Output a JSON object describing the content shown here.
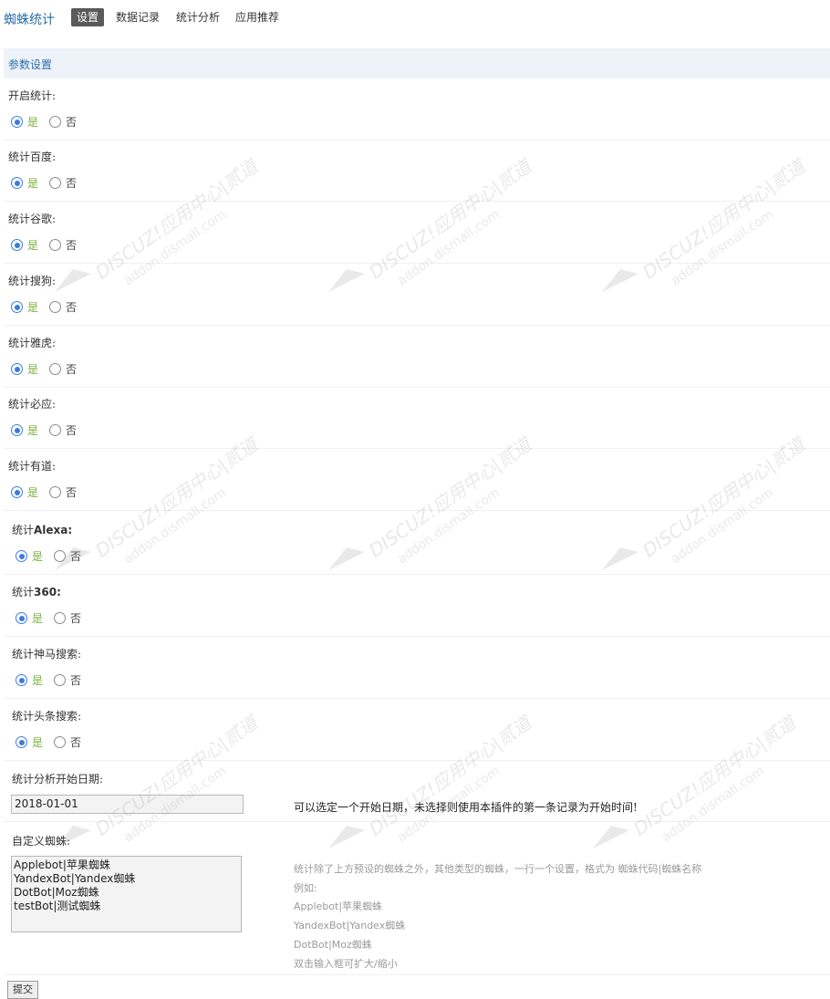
{
  "header": {
    "app_title": "蜘蛛统计",
    "tabs": [
      {
        "label": "设置",
        "active": true
      },
      {
        "label": "数据记录",
        "active": false
      },
      {
        "label": "统计分析",
        "active": false
      },
      {
        "label": "应用推荐",
        "active": false
      }
    ]
  },
  "section": {
    "title": "参数设置"
  },
  "options": {
    "yes": "是",
    "no": "否"
  },
  "settings": [
    {
      "label": "开启统计:",
      "value": "是"
    },
    {
      "label": "统计百度:",
      "value": "是"
    },
    {
      "label": "统计谷歌:",
      "value": "是"
    },
    {
      "label": "统计搜狗:",
      "value": "是"
    },
    {
      "label": "统计雅虎:",
      "value": "是"
    },
    {
      "label": "统计必应:",
      "value": "是"
    },
    {
      "label": "统计有道:",
      "value": "是"
    },
    {
      "label_prefix": "统计",
      "label_bold": "Alexa:",
      "value": "是"
    },
    {
      "label_prefix": "统计",
      "label_bold": "360:",
      "value": "是"
    },
    {
      "label": "统计神马搜索:",
      "value": "是"
    },
    {
      "label": "统计头条搜索:",
      "value": "是"
    }
  ],
  "start_date": {
    "label": "统计分析开始日期:",
    "value": "2018-01-01",
    "hint": "可以选定一个开始日期，未选择则使用本插件的第一条记录为开始时间!"
  },
  "custom_spiders": {
    "label": "自定义蜘蛛:",
    "value": "Applebot|苹果蜘蛛\nYandexBot|Yandex蜘蛛\nDotBot|Moz蜘蛛\ntestBot|测试蜘蛛",
    "hint_lines": [
      "统计除了上方预设的蜘蛛之外，其他类型的蜘蛛，一行一个设置，格式为 蜘蛛代码|蜘蛛名称",
      "例如:",
      "Applebot|苹果蜘蛛",
      "YandexBot|Yandex蜘蛛",
      "DotBot|Moz蜘蛛",
      "双击输入框可扩大/缩小"
    ]
  },
  "submit": {
    "label": "提交"
  },
  "watermark": {
    "line1": "DISCUZ!应用中心|贰道",
    "line2": "addon.dismall.com"
  },
  "colors": {
    "accent": "#2b6ea8",
    "yes_text": "#7ab13b",
    "radio": "#3b7be0",
    "section_bg": "#eef3fa"
  }
}
